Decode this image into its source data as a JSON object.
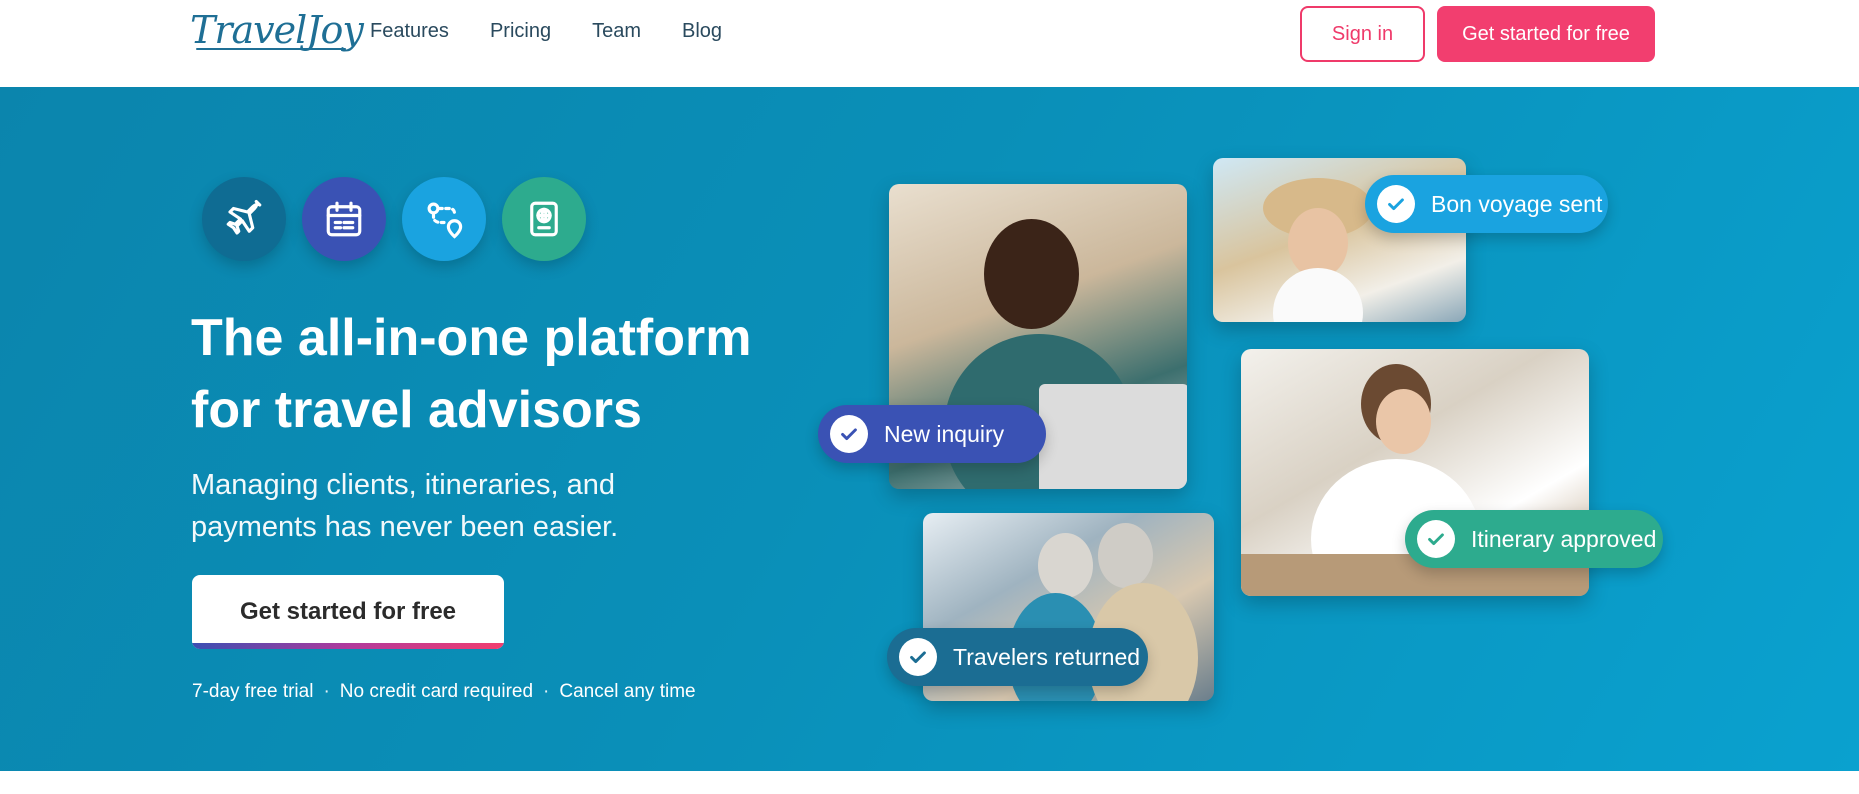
{
  "header": {
    "logo_text": "TravelJoy",
    "nav": [
      "Features",
      "Pricing",
      "Team",
      "Blog"
    ],
    "sign_in": "Sign in",
    "cta": "Get started for free"
  },
  "hero": {
    "icons": [
      {
        "name": "airplane-icon",
        "color": "#0f6c93"
      },
      {
        "name": "calendar-icon",
        "color": "#3a52b4"
      },
      {
        "name": "route-icon",
        "color": "#1aa3e0"
      },
      {
        "name": "passport-icon",
        "color": "#2dab8e"
      }
    ],
    "headline_line1": "The all-in-one platform",
    "headline_line2": "for travel advisors",
    "subhead_line1": "Managing clients, itineraries, and",
    "subhead_line2": "payments has never been easier.",
    "cta": "Get started for free",
    "trial_items": [
      "7-day free trial",
      "No credit card required",
      "Cancel any time"
    ],
    "separator": "·"
  },
  "status_pills": {
    "bon_voyage": "Bon voyage sent",
    "new_inquiry": "New inquiry",
    "itinerary": "Itinerary approved",
    "travelers": "Travelers returned"
  },
  "colors": {
    "brand_pink": "#f23e6f",
    "hero_blue": "#0a8fb8"
  }
}
